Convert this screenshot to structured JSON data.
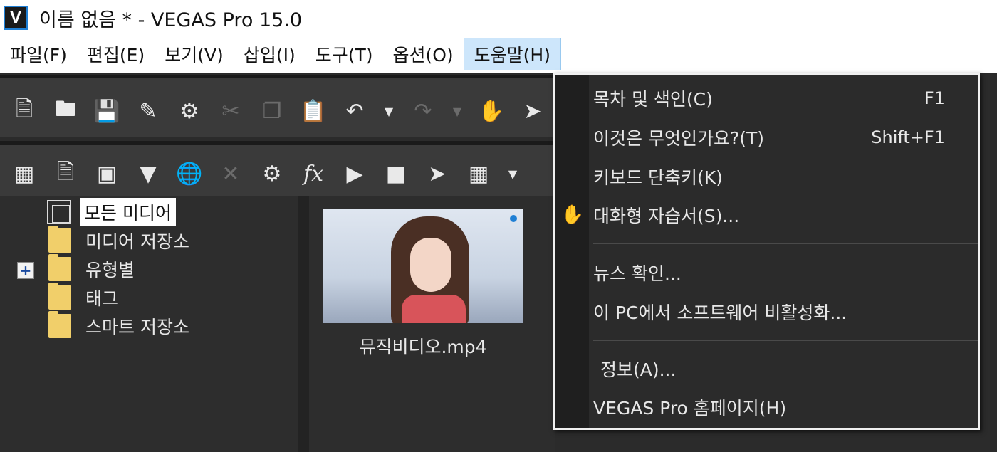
{
  "window": {
    "logo": "V",
    "title": "이름 없음 * - VEGAS Pro 15.0"
  },
  "menubar": {
    "items": [
      {
        "label": "파일(F)"
      },
      {
        "label": "편집(E)"
      },
      {
        "label": "보기(V)"
      },
      {
        "label": "삽입(I)"
      },
      {
        "label": "도구(T)"
      },
      {
        "label": "옵션(O)"
      },
      {
        "label": "도움말(H)"
      }
    ]
  },
  "toolbar1": {
    "icons": [
      "new-file-icon",
      "open-folder-icon",
      "save-icon",
      "save-as-icon",
      "gear-icon",
      "cut-icon",
      "copy-icon",
      "paste-icon",
      "undo-icon",
      "dropdown-arrow-icon",
      "redo-icon",
      "dropdown-arrow-icon",
      "whats-this-icon",
      "help-pointer-icon"
    ]
  },
  "toolbar2": {
    "icons": [
      "import-media-icon",
      "capture-icon",
      "get-media-icon",
      "media-from-device-icon",
      "web-media-icon",
      "delete-icon",
      "properties-gear-icon",
      "fx-icon",
      "play-icon",
      "stop-icon",
      "auto-preview-icon",
      "view-icon",
      "dropdown-arrow-icon"
    ]
  },
  "tree": {
    "all_media": "모든 미디어",
    "bins": [
      {
        "label": "미디어 저장소"
      },
      {
        "label": "유형별"
      },
      {
        "label": "태그"
      },
      {
        "label": "스마트 저장소"
      }
    ],
    "expand_glyph": "+"
  },
  "media": {
    "filename": "뮤직비디오.mp4"
  },
  "help_menu": {
    "items": [
      {
        "label": "목차 및 색인(C)",
        "shortcut": "F1"
      },
      {
        "label": "이것은 무엇인가요?(T)",
        "shortcut": "Shift+F1"
      },
      {
        "label": "키보드 단축키(K)",
        "shortcut": ""
      },
      {
        "label": "대화형 자습서(S)...",
        "shortcut": ""
      },
      {
        "label": "뉴스 확인...",
        "shortcut": ""
      },
      {
        "label": "이 PC에서 소프트웨어 비활성화...",
        "shortcut": ""
      },
      {
        "label": "정보(A)...",
        "shortcut": ""
      },
      {
        "label": "VEGAS Pro 홈페이지(H)",
        "shortcut": ""
      }
    ]
  },
  "colors": {
    "accent": "#1f7fd4",
    "menu_highlight": "#cde6fb",
    "folder": "#f1cf6a",
    "panel": "#2d2d2d"
  }
}
